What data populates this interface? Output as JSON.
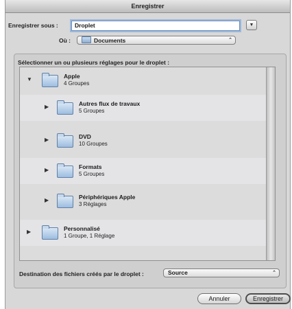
{
  "window": {
    "title": "Enregistrer"
  },
  "save_as": {
    "label": "Enregistrer sous :",
    "value": "Droplet"
  },
  "where": {
    "label": "Où :",
    "value": "Documents"
  },
  "settings": {
    "heading": "Sélectionner un ou plusieurs réglages pour le droplet :",
    "items": [
      {
        "title": "Apple",
        "subtitle": "4 Groupes",
        "state": "expanded"
      },
      {
        "title": "Autres flux de travaux",
        "subtitle": "5 Groupes",
        "state": "collapsed"
      },
      {
        "title": "DVD",
        "subtitle": "10 Groupes",
        "state": "collapsed"
      },
      {
        "title": "Formats",
        "subtitle": "5 Groupes",
        "state": "collapsed"
      },
      {
        "title": "Périphériques Apple",
        "subtitle": "3 Réglages",
        "state": "collapsed"
      },
      {
        "title": "Personnalisé",
        "subtitle": "1 Groupe, 1 Réglage",
        "state": "collapsed"
      }
    ]
  },
  "destination": {
    "label": "Destination des fichiers créés par le droplet :",
    "value": "Source"
  },
  "buttons": {
    "cancel": "Annuler",
    "save": "Enregistrer"
  },
  "icons": {
    "expanded": "▼",
    "collapsed": "▶",
    "expand_dialog": "▼",
    "popup_arrows": "⌃⌄"
  }
}
